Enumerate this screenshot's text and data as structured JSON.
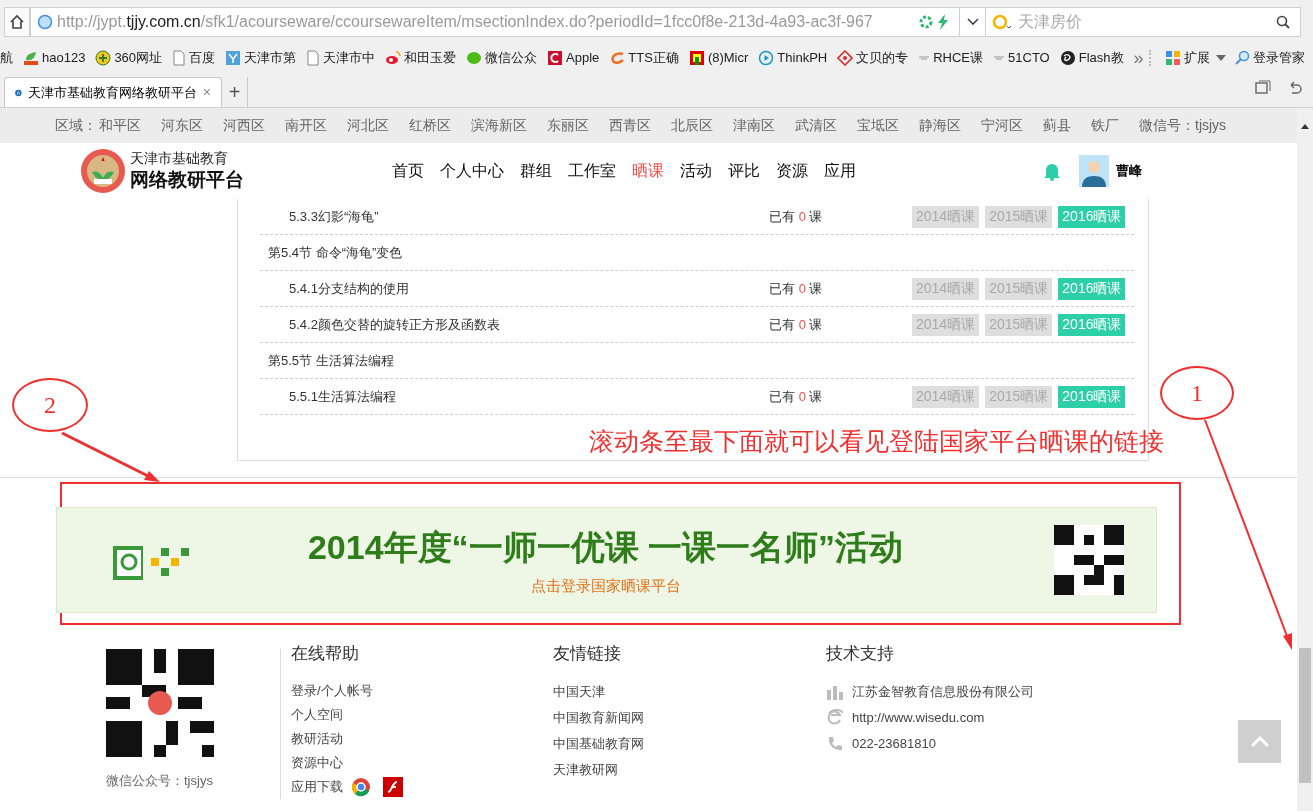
{
  "browser": {
    "url_parts": [
      {
        "text": "http://jypt.",
        "emphasis": false
      },
      {
        "text": "tjjy.com.cn",
        "emphasis": true
      },
      {
        "text": "/sfk1/acourseware/ccoursewareItem/msectionIndex.do?periodId=1fcc0f8e-213d-4a93-ac3f-967",
        "emphasis": false
      }
    ],
    "search": {
      "placeholder": "天津房价"
    },
    "bookmarks": [
      {
        "label": "航"
      },
      {
        "label": "hao123"
      },
      {
        "label": "360网址"
      },
      {
        "label": "百度"
      },
      {
        "label": "天津市第"
      },
      {
        "label": "天津市中"
      },
      {
        "label": "和田玉爱"
      },
      {
        "label": "微信公众"
      },
      {
        "label": "Apple"
      },
      {
        "label": "TTS正确"
      },
      {
        "label": "(8)Micr"
      },
      {
        "label": "ThinkPH"
      },
      {
        "label": "文贝的专"
      },
      {
        "label": "RHCE课"
      },
      {
        "label": "51CTO"
      },
      {
        "label": "Flash教"
      }
    ],
    "more": "»",
    "extensions": "扩展",
    "login_manager": "登录管家",
    "tabs": [
      {
        "title": "天津市基础教育网络教研平台",
        "selected": true,
        "close": "×"
      }
    ],
    "new_tab": "+"
  },
  "page": {
    "region_label": "区域：",
    "districts": [
      "和平区",
      "河东区",
      "河西区",
      "南开区",
      "河北区",
      "红桥区",
      "滨海新区",
      "东丽区",
      "西青区",
      "北辰区",
      "津南区",
      "武清区",
      "宝坻区",
      "静海区",
      "宁河区",
      "蓟县",
      "铁厂"
    ],
    "wechat_id": "微信号：tjsjys",
    "logo": {
      "line_1": "天津市基础教育",
      "line_2": "网络教研平台"
    },
    "nav": [
      {
        "label": "首页",
        "selected": false
      },
      {
        "label": "个人中心",
        "selected": false
      },
      {
        "label": "群组",
        "selected": false
      },
      {
        "label": "工作室",
        "selected": false
      },
      {
        "label": "晒课",
        "selected": true
      },
      {
        "label": "活动",
        "selected": false
      },
      {
        "label": "评比",
        "selected": false
      },
      {
        "label": "资源",
        "selected": false
      },
      {
        "label": "应用",
        "selected": false
      }
    ],
    "user_name": "曹峰",
    "rows": [
      {
        "kind": "lesson",
        "title": "5.3.3幻影“海龟”",
        "prefix": "已有",
        "count": "0",
        "suffix": "课",
        "buttons": [
          {
            "label": "2014晒课",
            "active": false
          },
          {
            "label": "2015晒课",
            "active": false
          },
          {
            "label": "2016晒课",
            "active": true
          }
        ]
      },
      {
        "kind": "section",
        "title": "第5.4节 命令“海龟”变色"
      },
      {
        "kind": "lesson",
        "title": "5.4.1分支结构的使用",
        "prefix": "已有",
        "count": "0",
        "suffix": "课",
        "buttons": [
          {
            "label": "2014晒课",
            "active": false
          },
          {
            "label": "2015晒课",
            "active": false
          },
          {
            "label": "2016晒课",
            "active": true
          }
        ]
      },
      {
        "kind": "lesson",
        "title": "5.4.2颜色交替的旋转正方形及函数表",
        "prefix": "已有",
        "count": "0",
        "suffix": "课",
        "buttons": [
          {
            "label": "2014晒课",
            "active": false
          },
          {
            "label": "2015晒课",
            "active": false
          },
          {
            "label": "2016晒课",
            "active": true
          }
        ]
      },
      {
        "kind": "section",
        "title": "第5.5节 生活算法编程"
      },
      {
        "kind": "lesson",
        "title": "5.5.1生活算法编程",
        "prefix": "已有",
        "count": "0",
        "suffix": "课",
        "buttons": [
          {
            "label": "2014晒课",
            "active": false
          },
          {
            "label": "2015晒课",
            "active": false
          },
          {
            "label": "2016晒课",
            "active": true
          }
        ]
      }
    ],
    "annotation": "滚动条至最下面就可以看见登陆国家平台晒课的链接",
    "markers": [
      "1",
      "2"
    ],
    "banner": {
      "title": "2014年度“一师一优课 一课一名师”活动",
      "subtitle": "点击登录国家晒课平台"
    },
    "footer": {
      "qr_caption": "微信公众号：tjsjys",
      "columns": [
        {
          "heading": "在线帮助",
          "items": [
            {
              "label": "登录/个人帐号"
            },
            {
              "label": "个人空间"
            },
            {
              "label": "教研活动"
            },
            {
              "label": "资源中心"
            },
            {
              "label": "应用下载"
            }
          ]
        },
        {
          "heading": "友情链接",
          "items": [
            {
              "label": "中国天津"
            },
            {
              "label": "中国教育新闻网"
            },
            {
              "label": "中国基础教育网"
            },
            {
              "label": "天津教研网"
            }
          ]
        },
        {
          "heading": "技术支持",
          "items": [
            {
              "label": "江苏金智教育信息股份有限公司"
            },
            {
              "label": "http://www.wisedu.com"
            },
            {
              "label": "022-23681810"
            }
          ]
        }
      ]
    }
  }
}
